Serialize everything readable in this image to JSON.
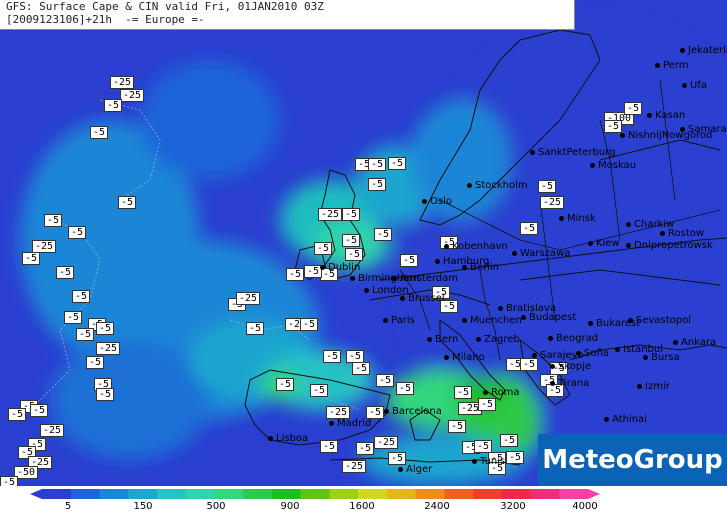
{
  "header": {
    "line1": "GFS: Surface Cape & CIN valid Fri, 01JAN2010 03Z",
    "line2": "[2009123106]+21h  -= Europe =-"
  },
  "brand": "MeteoGroup",
  "legend": {
    "colors": [
      "#2a3fd0",
      "#1f63d8",
      "#1c86d6",
      "#1ea6cf",
      "#25c2c4",
      "#2fd3ac",
      "#33d57d",
      "#2ec94a",
      "#1fbc24",
      "#5ec417",
      "#9ad018",
      "#d0d81b",
      "#e4b61d",
      "#ee8b1f",
      "#f06020",
      "#f23d2c",
      "#f5264a",
      "#f62a78",
      "#f73fa8"
    ],
    "ticks": [
      "5",
      "150",
      "500",
      "900",
      "1600",
      "2400",
      "3200",
      "4000"
    ]
  },
  "cities": [
    {
      "name": "Jekaterinburg"
    },
    {
      "name": "Perm"
    },
    {
      "name": "Ufa"
    },
    {
      "name": "Kasan"
    },
    {
      "name": "Samara"
    },
    {
      "name": "NishnijNowgorod"
    },
    {
      "name": "SanktPeterburg"
    },
    {
      "name": "Moskau"
    },
    {
      "name": "Stockholm"
    },
    {
      "name": "Oslo"
    },
    {
      "name": "Minsk"
    },
    {
      "name": "Charkiw"
    },
    {
      "name": "Rostow"
    },
    {
      "name": "Kiew"
    },
    {
      "name": "Dnipropetrowsk"
    },
    {
      "name": "Kobenhavn"
    },
    {
      "name": "Hamburg"
    },
    {
      "name": "Berlin"
    },
    {
      "name": "Warszawa"
    },
    {
      "name": "Dublin"
    },
    {
      "name": "Birmingham"
    },
    {
      "name": "Amsterdam"
    },
    {
      "name": "London"
    },
    {
      "name": "Brussel"
    },
    {
      "name": "Paris"
    },
    {
      "name": "Muenchen"
    },
    {
      "name": "Bratislava"
    },
    {
      "name": "Budapest"
    },
    {
      "name": "Bern"
    },
    {
      "name": "Zagreb"
    },
    {
      "name": "Beograd"
    },
    {
      "name": "Bukarest"
    },
    {
      "name": "Sevastopol"
    },
    {
      "name": "Ankara"
    },
    {
      "name": "Istanbul"
    },
    {
      "name": "Bursa"
    },
    {
      "name": "Sarajevo"
    },
    {
      "name": "Sofia"
    },
    {
      "name": "Skopje"
    },
    {
      "name": "Tirana"
    },
    {
      "name": "Milano"
    },
    {
      "name": "Roma"
    },
    {
      "name": "Izmir"
    },
    {
      "name": "Athinai"
    },
    {
      "name": "Barcelona"
    },
    {
      "name": "Madrid"
    },
    {
      "name": "Lisboa"
    },
    {
      "name": "Alger"
    },
    {
      "name": "Tunis"
    }
  ],
  "cin_labels": [
    "-25",
    "-25",
    "-5",
    "-5",
    "-5",
    "-5",
    "-5",
    "-5",
    "-5",
    "-25",
    "-5",
    "-5",
    "-5",
    "-25",
    "-5",
    "-5",
    "-5",
    "-5",
    "-5",
    "-5",
    "-5",
    "-25",
    "-5",
    "-5",
    "-5",
    "-5",
    "-5",
    "-25",
    "-5",
    "-5",
    "-5",
    "-5",
    "-25",
    "-5",
    "-5",
    "-5",
    "-5",
    "-5",
    "-5",
    "-5",
    "-5",
    "-5",
    "-5",
    "-5",
    "-5",
    "-5",
    "-5",
    "-5",
    "-25",
    "-5",
    "-5",
    "-25",
    "-25",
    "-5",
    "-5",
    "-5",
    "-25",
    "-5",
    "-5",
    "-5",
    "-5",
    "-5",
    "-5",
    "-5",
    "-5",
    "-5",
    "-5",
    "-5",
    "-5",
    "-5",
    "-5",
    "-5",
    "-25",
    "-5",
    "-5",
    "-25",
    "-50",
    "-5",
    "-5",
    "-25",
    "-5",
    "-100",
    "-5",
    "-5",
    "-5"
  ]
}
